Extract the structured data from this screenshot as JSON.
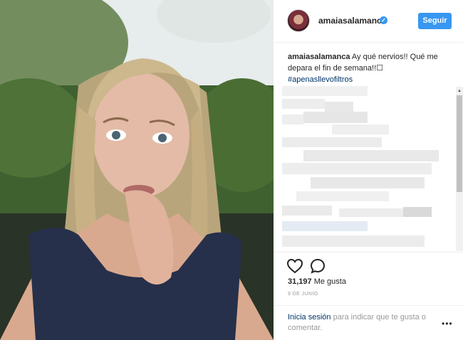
{
  "post": {
    "username": "amaiasalamanca",
    "verified": true,
    "follow_label": "Seguir",
    "caption_user": "amaiasalamanca",
    "caption_text": "Ay qué nervios!! Qué me depara el fin de semana!!☐",
    "caption_hashtag": "#apenasllevofiltros",
    "likes_count": "31,197",
    "likes_label": "Me gusta",
    "date": "9 DE JUNIO",
    "login_link": "Inicia sesión",
    "login_text": " para indicar que te gusta o comentar.",
    "more_label": "•••"
  },
  "icons": {
    "like": "heart-icon",
    "comment": "comment-icon",
    "verified": "verified-badge-icon",
    "more": "more-options-icon"
  },
  "colors": {
    "accent": "#3897f0",
    "link": "#003569",
    "muted": "#999999",
    "text": "#262626"
  }
}
